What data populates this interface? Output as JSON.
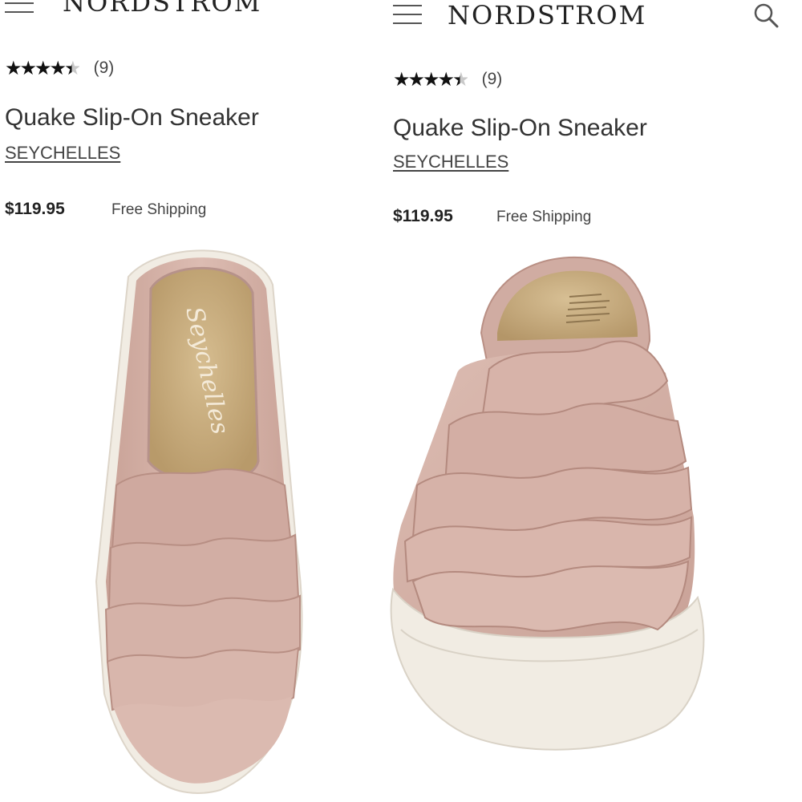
{
  "screens": [
    {
      "brand": "NORDSTROM",
      "rating": {
        "value": 4.5,
        "count_label": "(9)"
      },
      "product": {
        "title": "Quake Slip-On Sneaker",
        "brand": "SEYCHELLES",
        "price": "$119.95",
        "shipping": "Free Shipping"
      },
      "image": {
        "view": "top-down",
        "insole_logo": "Seychelles"
      },
      "icons": [
        "hamburger-menu-icon"
      ]
    },
    {
      "brand": "NORDSTROM",
      "rating": {
        "value": 4.5,
        "count_label": "(9)"
      },
      "product": {
        "title": "Quake Slip-On Sneaker",
        "brand": "SEYCHELLES",
        "price": "$119.95",
        "shipping": "Free Shipping"
      },
      "image": {
        "view": "front"
      },
      "icons": [
        "hamburger-menu-icon",
        "search-icon"
      ]
    }
  ],
  "colors": {
    "suede": "#d8b6ac",
    "suede_shadow": "#bf968b",
    "insole": "#c8ac7e",
    "sole": "#f1ece3"
  }
}
